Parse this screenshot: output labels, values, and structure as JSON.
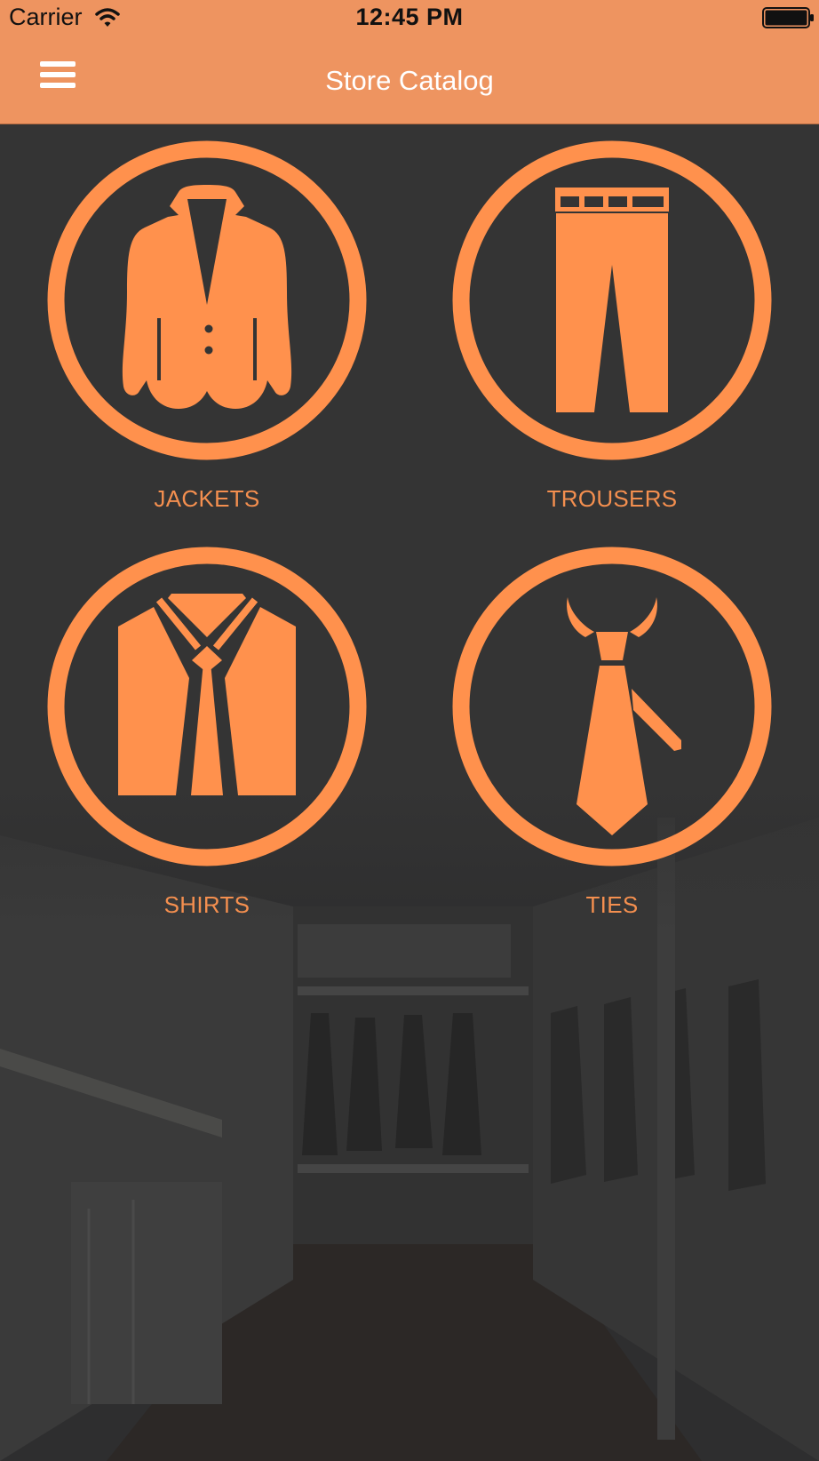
{
  "status_bar": {
    "carrier": "Carrier",
    "time": "12:45 PM",
    "wifi_icon": "wifi-icon",
    "battery_icon": "battery-full-icon"
  },
  "nav": {
    "title": "Store Catalog",
    "menu_icon": "hamburger-menu-icon"
  },
  "categories": [
    {
      "label": "JACKETS",
      "icon": "jacket-icon"
    },
    {
      "label": "TROUSERS",
      "icon": "trousers-icon"
    },
    {
      "label": "SHIRTS",
      "icon": "shirt-icon"
    },
    {
      "label": "TIES",
      "icon": "tie-icon"
    }
  ],
  "colors": {
    "header": "#ee9460",
    "accent": "#ff914d",
    "background": "#343434",
    "title_text": "#ffffff"
  }
}
